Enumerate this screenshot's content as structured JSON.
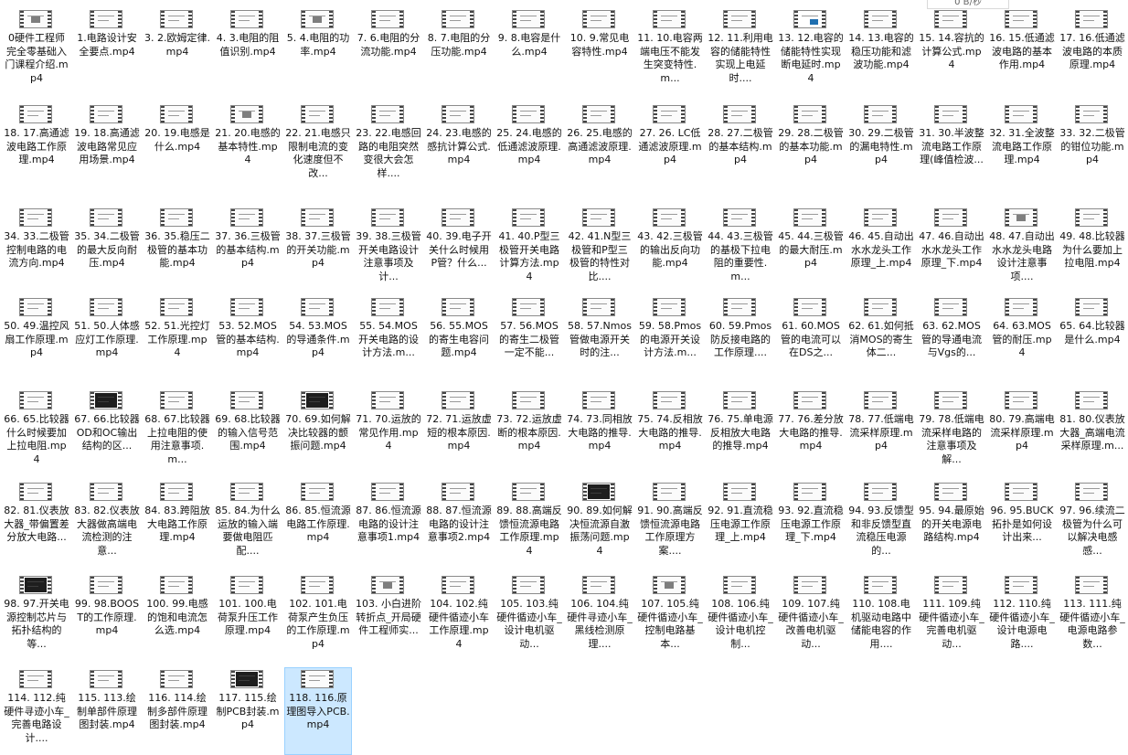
{
  "status": {
    "speed": "0 B/秒"
  },
  "files": [
    {
      "label": "0硬件工程师完全零基础入门课程介绍.mp4",
      "thumb": "pic"
    },
    {
      "label": "1.电路设计安全要点.mp4",
      "thumb": "plain"
    },
    {
      "label": "3. 2.欧姆定律.mp4",
      "thumb": "plain"
    },
    {
      "label": "4. 3.电阻的阻值识别.mp4",
      "thumb": "plain"
    },
    {
      "label": "5. 4.电阻的功率.mp4",
      "thumb": "pic"
    },
    {
      "label": "7. 6.电阻的分流功能.mp4",
      "thumb": "plain"
    },
    {
      "label": "8. 7.电阻的分压功能.mp4",
      "thumb": "plain"
    },
    {
      "label": "9. 8.电容是什么.mp4",
      "thumb": "plain"
    },
    {
      "label": "10. 9.常见电容特性.mp4",
      "thumb": "plain"
    },
    {
      "label": "11. 10.电容两端电压不能发生突变特性.m...",
      "thumb": "plain"
    },
    {
      "label": "12. 11.利用电容的储能特性实现上电延时....",
      "thumb": "plain"
    },
    {
      "label": "13. 12.电容的储能特性实现断电延时.mp4",
      "thumb": "blue"
    },
    {
      "label": "14. 13.电容的稳压功能和滤波功能.mp4",
      "thumb": "plain"
    },
    {
      "label": "15. 14.容抗的计算公式.mp4",
      "thumb": "plain"
    },
    {
      "label": "16. 15.低通滤波电路的基本作用.mp4",
      "thumb": "plain"
    },
    {
      "label": "17. 16.低通滤波电路的本质原理.mp4",
      "thumb": "plain"
    },
    {
      "label": "18. 17.高通滤波电路工作原理.mp4",
      "thumb": "plain"
    },
    {
      "label": "19. 18.高通滤波电路常见应用场景.mp4",
      "thumb": "plain"
    },
    {
      "label": "20. 19.电感是什么.mp4",
      "thumb": "plain"
    },
    {
      "label": "21. 20.电感的基本特性.mp4",
      "thumb": "pic"
    },
    {
      "label": "22. 21.电感只限制电流的变化速度但不改...",
      "thumb": "plain"
    },
    {
      "label": "23. 22.电感回路的电阻突然变很大会怎样....",
      "thumb": "plain"
    },
    {
      "label": "24. 23.电感的感抗计算公式.mp4",
      "thumb": "plain"
    },
    {
      "label": "25. 24.电感的低通滤波原理.mp4",
      "thumb": "plain"
    },
    {
      "label": "26. 25.电感的高通滤波原理.mp4",
      "thumb": "plain"
    },
    {
      "label": "27. 26. LC低通滤波原理.mp4",
      "thumb": "plain"
    },
    {
      "label": "28. 27.二极管的基本结构.mp4",
      "thumb": "plain"
    },
    {
      "label": "29. 28.二极管的基本功能.mp4",
      "thumb": "plain"
    },
    {
      "label": "30. 29.二极管的漏电特性.mp4",
      "thumb": "plain"
    },
    {
      "label": "31. 30.半波整流电路工作原理(峰值检波...",
      "thumb": "plain"
    },
    {
      "label": "32. 31.全波整流电路工作原理.mp4",
      "thumb": "plain"
    },
    {
      "label": "33. 32.二极管的钳位功能.mp4",
      "thumb": "plain"
    },
    {
      "label": "34. 33.二极管控制电路的电流方向.mp4",
      "thumb": "plain"
    },
    {
      "label": "35. 34.二极管的最大反向耐压.mp4",
      "thumb": "plain"
    },
    {
      "label": "36. 35.稳压二极管的基本功能.mp4",
      "thumb": "plain"
    },
    {
      "label": "37. 36.三极管的基本结构.mp4",
      "thumb": "plain"
    },
    {
      "label": "38. 37.三极管的开关功能.mp4",
      "thumb": "plain"
    },
    {
      "label": "39. 38.三极管开关电路设计注意事项及计...",
      "thumb": "plain"
    },
    {
      "label": "40. 39.电子开关什么时候用P管？什么...",
      "thumb": "plain"
    },
    {
      "label": "41. 40.P型三极管开关电路计算方法.mp4",
      "thumb": "plain"
    },
    {
      "label": "42. 41.N型三极管和P型三极管的特性对比....",
      "thumb": "plain"
    },
    {
      "label": "43. 42.三极管的输出反向功能.mp4",
      "thumb": "plain"
    },
    {
      "label": "44. 43.三极管的基极下拉电阻的重要性.m...",
      "thumb": "plain"
    },
    {
      "label": "45. 44.三极管的最大耐压.mp4",
      "thumb": "plain"
    },
    {
      "label": "46. 45.自动出水水龙头工作原理_上.mp4",
      "thumb": "plain"
    },
    {
      "label": "47. 46.自动出水水龙头工作原理_下.mp4",
      "thumb": "plain"
    },
    {
      "label": "48. 47.自动出水水龙头电路设计注意事项....",
      "thumb": "pic"
    },
    {
      "label": "49. 48.比较器为什么要加上拉电阻.mp4",
      "thumb": "plain"
    },
    {
      "label": "50. 49.温控风扇工作原理.mp4",
      "thumb": "plain"
    },
    {
      "label": "51. 50.人体感应灯工作原理.mp4",
      "thumb": "plain"
    },
    {
      "label": "52. 51.光控灯工作原理.mp4",
      "thumb": "plain"
    },
    {
      "label": "53. 52.MOS管的基本结构.mp4",
      "thumb": "plain"
    },
    {
      "label": "54. 53.MOS的导通条件.mp4",
      "thumb": "plain"
    },
    {
      "label": "55. 54.MOS开关电路的设计方法.m...",
      "thumb": "plain"
    },
    {
      "label": "56. 55.MOS的寄生电容问题.mp4",
      "thumb": "plain"
    },
    {
      "label": "57. 56.MOS的寄生二极管一定不能...",
      "thumb": "plain"
    },
    {
      "label": "58. 57.Nmos管做电源开关时的注...",
      "thumb": "plain"
    },
    {
      "label": "59. 58.Pmos的电源开关设计方法.m...",
      "thumb": "plain"
    },
    {
      "label": "60. 59.Pmos防反接电路的工作原理....",
      "thumb": "plain"
    },
    {
      "label": "61. 60.MOS管的电流可以在DS之...",
      "thumb": "plain"
    },
    {
      "label": "62. 61.如何抵消MOS的寄生体二...",
      "thumb": "plain"
    },
    {
      "label": "63. 62.MOS管的导通电流与Vgs的...",
      "thumb": "plain"
    },
    {
      "label": "64. 63.MOS管的耐压.mp4",
      "thumb": "plain"
    },
    {
      "label": "65. 64.比较器是什么.mp4",
      "thumb": "plain"
    },
    {
      "label": "66. 65.比较器什么时候要加上拉电阻.mp4",
      "thumb": "plain"
    },
    {
      "label": "67. 66.比较器OD和OC输出结构的区...",
      "thumb": "dark"
    },
    {
      "label": "68. 67.比较器上拉电阻的使用注意事项.m...",
      "thumb": "plain"
    },
    {
      "label": "69. 68.比较器的输入信号范围.mp4",
      "thumb": "plain"
    },
    {
      "label": "70. 69.如何解决比较器的颤振问题.mp4",
      "thumb": "dark"
    },
    {
      "label": "71. 70.运放的常见作用.mp4",
      "thumb": "plain"
    },
    {
      "label": "72. 71.运放虚短的根本原因.mp4",
      "thumb": "plain"
    },
    {
      "label": "73. 72.运放虚断的根本原因.mp4",
      "thumb": "plain"
    },
    {
      "label": "74. 73.同相放大电路的推导.mp4",
      "thumb": "plain"
    },
    {
      "label": "75. 74.反相放大电路的推导.mp4",
      "thumb": "plain"
    },
    {
      "label": "76. 75.单电源反相放大电路的推导.mp4",
      "thumb": "plain"
    },
    {
      "label": "77. 76.差分放大电路的推导.mp4",
      "thumb": "plain"
    },
    {
      "label": "78. 77.低端电流采样原理.mp4",
      "thumb": "plain"
    },
    {
      "label": "79. 78.低端电流采样电路的注意事项及解...",
      "thumb": "plain"
    },
    {
      "label": "80. 79.高端电流采样原理.mp4",
      "thumb": "plain"
    },
    {
      "label": "81. 80.仪表放大器_高端电流采样原理.m...",
      "thumb": "plain"
    },
    {
      "label": "82. 81.仪表放大器_带偏置差分放大电路...",
      "thumb": "plain"
    },
    {
      "label": "83. 82.仪表放大器做高端电流检测的注意...",
      "thumb": "plain"
    },
    {
      "label": "84. 83.跨阻放大电路工作原理.mp4",
      "thumb": "plain"
    },
    {
      "label": "85. 84.为什么运放的输入端要做电阻匹配....",
      "thumb": "plain"
    },
    {
      "label": "86. 85.恒流源电路工作原理.mp4",
      "thumb": "plain"
    },
    {
      "label": "87. 86.恒流源电路的设计注意事项1.mp4",
      "thumb": "plain"
    },
    {
      "label": "88. 87.恒流源电路的设计注意事项2.mp4",
      "thumb": "plain"
    },
    {
      "label": "89. 88.高端反馈恒流源电路工作原理.mp4",
      "thumb": "plain"
    },
    {
      "label": "90. 89.如何解决恒流源自激振荡问题.mp4",
      "thumb": "dark"
    },
    {
      "label": "91. 90.高端反馈恒流源电路工作原理方案....",
      "thumb": "plain"
    },
    {
      "label": "92. 91.直流稳压电源工作原理_上.mp4",
      "thumb": "plain"
    },
    {
      "label": "93. 92.直流稳压电源工作原理_下.mp4",
      "thumb": "plain"
    },
    {
      "label": "94. 93.反馈型和非反馈型直流稳压电源的...",
      "thumb": "plain"
    },
    {
      "label": "95. 94.最原始的开关电源电路结构.mp4",
      "thumb": "plain"
    },
    {
      "label": "96. 95.BUCK拓扑是如何设计出来...",
      "thumb": "plain"
    },
    {
      "label": "97. 96.续流二极管为什么可以解决电感感...",
      "thumb": "plain"
    },
    {
      "label": "98. 97.开关电源控制芯片与拓扑结构的等...",
      "thumb": "dark"
    },
    {
      "label": "99. 98.BOOST的工作原理.mp4",
      "thumb": "plain"
    },
    {
      "label": "100. 99.电感的饱和电流怎么选.mp4",
      "thumb": "plain"
    },
    {
      "label": "101. 100.电荷泵升压工作原理.mp4",
      "thumb": "plain"
    },
    {
      "label": "102. 101.电荷泵产生负压的工作原理.mp4",
      "thumb": "plain"
    },
    {
      "label": "103. 小白进阶转折点_开局硬件工程师实...",
      "thumb": "pic"
    },
    {
      "label": "104. 102.纯硬件循迹小车工作原理.mp4",
      "thumb": "plain"
    },
    {
      "label": "105. 103.纯硬件循迹小车_设计电机驱动...",
      "thumb": "plain"
    },
    {
      "label": "106. 104.纯硬件寻迹小车_黑线检测原理....",
      "thumb": "plain"
    },
    {
      "label": "107. 105.纯硬件循迹小车_控制电路基本...",
      "thumb": "pic"
    },
    {
      "label": "108. 106.纯硬件循迹小车_设计电机控制...",
      "thumb": "plain"
    },
    {
      "label": "109. 107.纯硬件循迹小车_改善电机驱动...",
      "thumb": "plain"
    },
    {
      "label": "110. 108.电机驱动电路中储能电容的作用....",
      "thumb": "plain"
    },
    {
      "label": "111. 109.纯硬件循迹小车_完善电机驱动...",
      "thumb": "plain"
    },
    {
      "label": "112. 110.纯硬件循迹小车_设计电源电路....",
      "thumb": "plain"
    },
    {
      "label": "113. 111.纯硬件循迹小车_电源电路参数...",
      "thumb": "plain"
    },
    {
      "label": "114. 112.纯硬件寻迹小车_完善电路设计....",
      "thumb": "plain"
    },
    {
      "label": "115. 113.绘制单部件原理图封装.mp4",
      "thumb": "plain"
    },
    {
      "label": "116. 114.绘制多部件原理图封装.mp4",
      "thumb": "plain"
    },
    {
      "label": "117. 115.绘制PCB封装.mp4",
      "thumb": "dark"
    },
    {
      "label": "118. 116.原理图导入PCB.mp4",
      "thumb": "plain",
      "selected": true
    }
  ]
}
